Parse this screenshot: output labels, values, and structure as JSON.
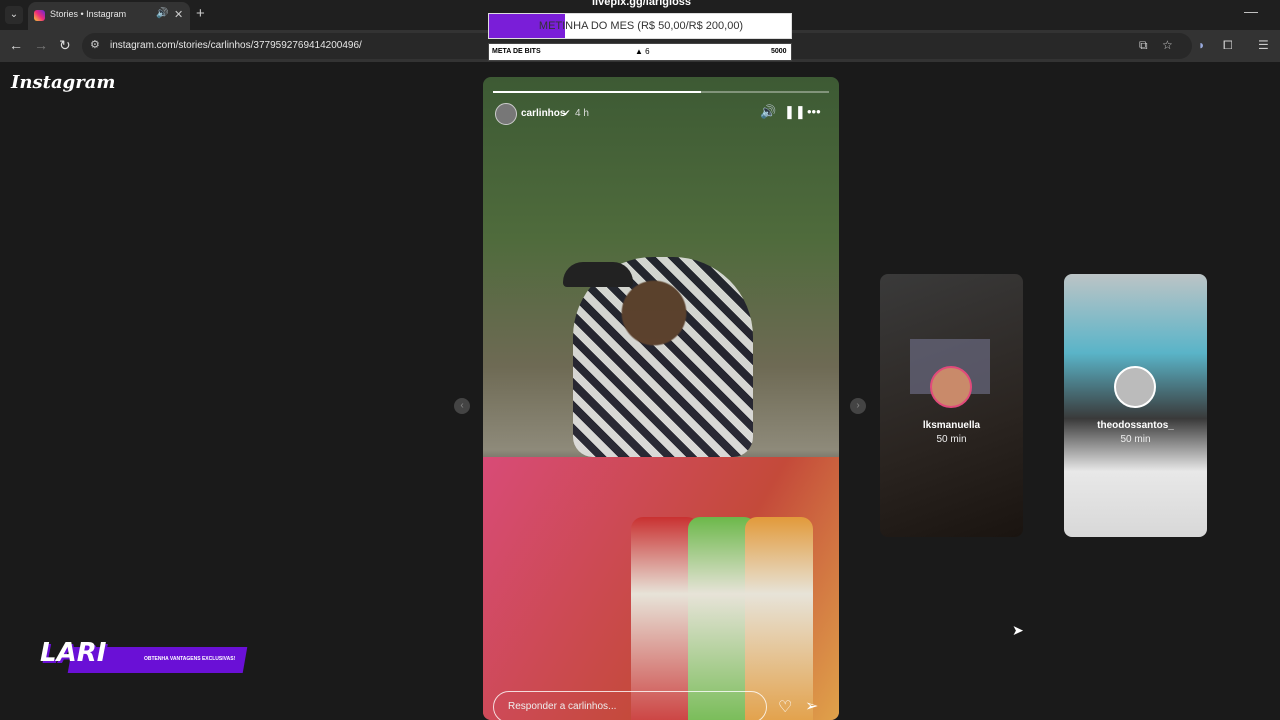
{
  "browser": {
    "tab": {
      "title": "Stories • Instagram"
    },
    "url": "instagram.com/stories/carlinhos/3779592769414200496/"
  },
  "instagram": {
    "logo": "Instagram",
    "story": {
      "username": "carlinhos",
      "time": "4 h",
      "progress_fraction": 0.62,
      "reply_placeholder": "Responder a carlinhos..."
    },
    "previews": [
      {
        "username": "lksmanuella",
        "time": "50 min"
      },
      {
        "username": "theodossantos_",
        "time": "50 min"
      }
    ]
  },
  "overlay": {
    "livepix_url": "livepix.gg/larigloss",
    "meta_text": "METINHA DO MES (R$ 50,00/R$ 200,00)",
    "meta_fill_fraction": 0.25,
    "bits_label": "META DE BITS",
    "bits_count": "6",
    "bits_goal": "5000",
    "lari_logo": "LARI",
    "lari_promo": "OBTENHA VANTAGENS EXCLUSIVAS!"
  }
}
